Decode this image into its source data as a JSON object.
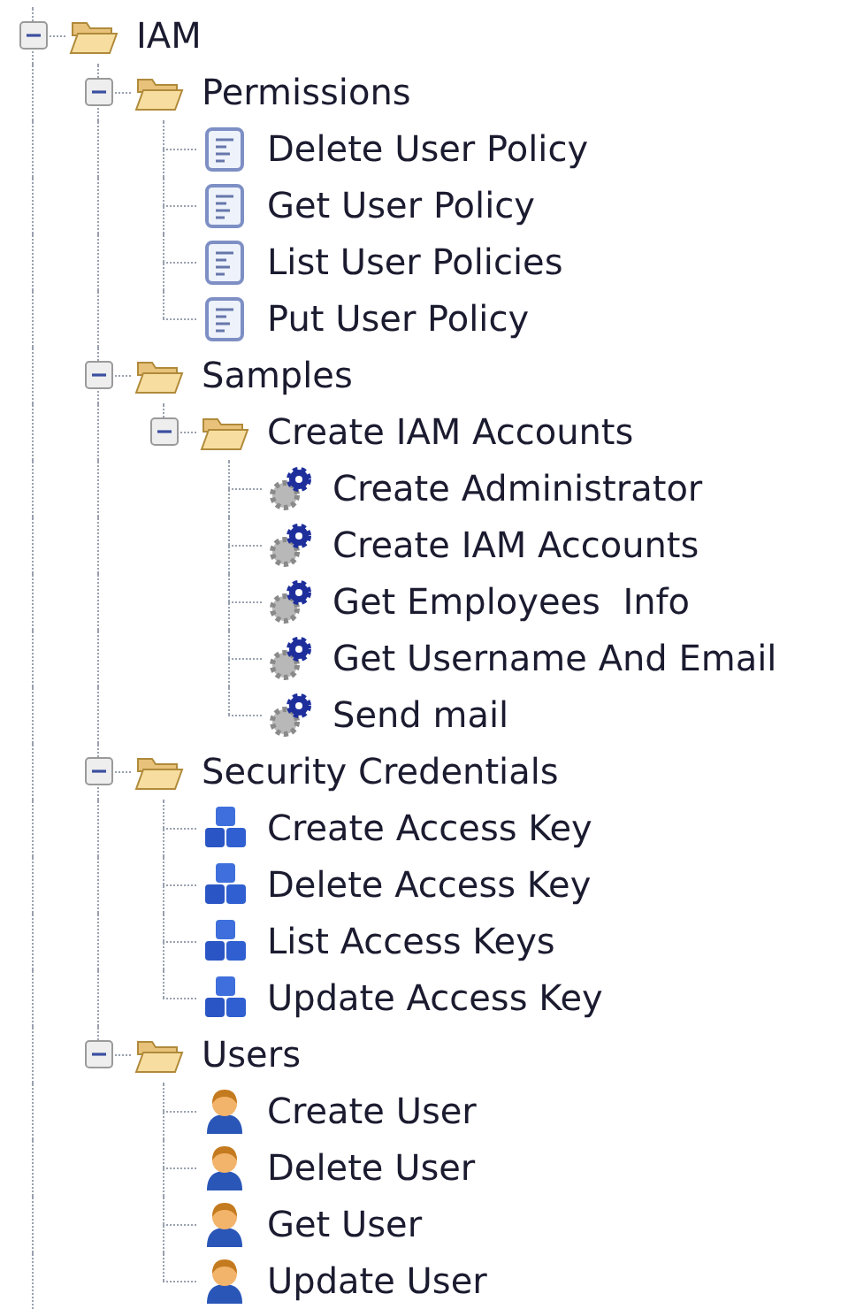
{
  "tree": [
    {
      "label": "IAM",
      "kind": "folder",
      "expanded": true,
      "children": [
        {
          "label": "Permissions",
          "kind": "folder",
          "expanded": true,
          "children": [
            {
              "label": "Delete User Policy",
              "kind": "document"
            },
            {
              "label": "Get User Policy",
              "kind": "document"
            },
            {
              "label": "List User Policies",
              "kind": "document"
            },
            {
              "label": "Put User Policy",
              "kind": "document"
            }
          ]
        },
        {
          "label": "Samples",
          "kind": "folder",
          "expanded": true,
          "children": [
            {
              "label": "Create IAM Accounts",
              "kind": "folder",
              "expanded": true,
              "children": [
                {
                  "label": "Create Administrator",
                  "kind": "gear"
                },
                {
                  "label": "Create IAM Accounts",
                  "kind": "gear"
                },
                {
                  "label": "Get Employees  Info",
                  "kind": "gear"
                },
                {
                  "label": "Get Username And Email",
                  "kind": "gear"
                },
                {
                  "label": "Send mail",
                  "kind": "gear"
                }
              ]
            }
          ]
        },
        {
          "label": "Security Credentials",
          "kind": "folder",
          "expanded": true,
          "children": [
            {
              "label": "Create Access Key",
              "kind": "cubes"
            },
            {
              "label": "Delete Access Key",
              "kind": "cubes"
            },
            {
              "label": "List Access Keys",
              "kind": "cubes"
            },
            {
              "label": "Update Access Key",
              "kind": "cubes"
            }
          ]
        },
        {
          "label": "Users",
          "kind": "folder",
          "expanded": true,
          "children": [
            {
              "label": "Create User",
              "kind": "user"
            },
            {
              "label": "Delete User",
              "kind": "user"
            },
            {
              "label": "Get User",
              "kind": "user"
            },
            {
              "label": "Update User",
              "kind": "user"
            }
          ]
        }
      ]
    }
  ]
}
